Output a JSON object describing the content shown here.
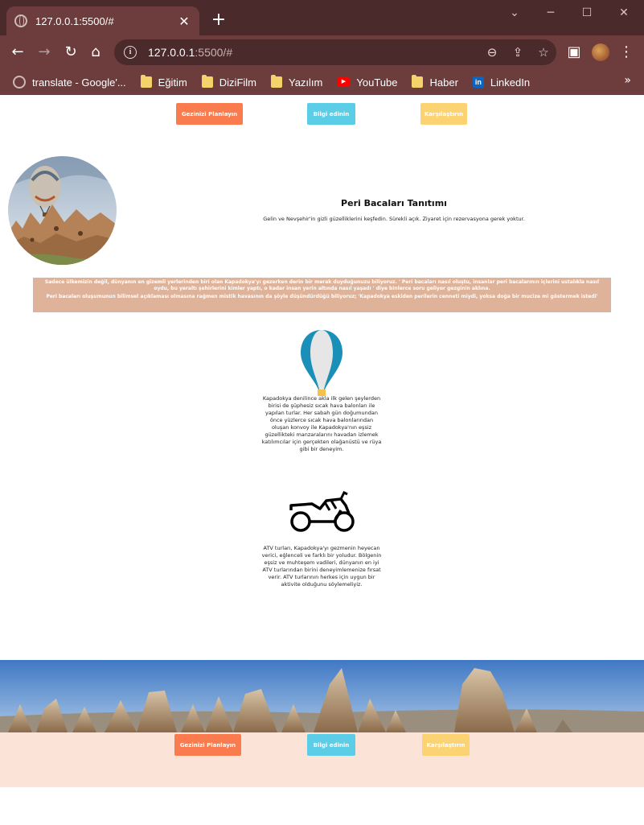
{
  "browser": {
    "tab_title": "127.0.0.1:5500/#",
    "url_host": "127.0.0.1",
    "url_rest": ":5500/#",
    "bookmarks": [
      {
        "label": "translate - Google'...",
        "icon": "google-icon"
      },
      {
        "label": "Eğitim",
        "icon": "folder-icon"
      },
      {
        "label": "DiziFilm",
        "icon": "folder-icon"
      },
      {
        "label": "Yazılım",
        "icon": "folder-icon"
      },
      {
        "label": "YouTube",
        "icon": "youtube-icon"
      },
      {
        "label": "Haber",
        "icon": "folder-icon"
      },
      {
        "label": "LinkedIn",
        "icon": "linkedin-icon"
      }
    ],
    "more": "»"
  },
  "nav": {
    "plan_label": "Gezinizi Planlayın",
    "info_label": "Bilgi edinin",
    "compare_label": "Karşılaştırın"
  },
  "intro": {
    "title": "Peri Bacaları Tanıtımı",
    "text": "Gelin ve Nevşehir'in gizli güzelliklerini keşfedin. Sürekli açık. Ziyaret için rezervasyona gerek yoktur."
  },
  "band": {
    "p1": "Sadece ülkemizin değil, dünyanın en gizemli yerlerinden biri olan Kapadokya'yı gezerken derin bir merak duyduğunuzu biliyoruz. ' Peri bacaları nasıl oluştu, insanlar peri bacalarının içlerini ustalıkla nasıl oydu, bu yeraltı şehirlerini kimler yaptı, o kadar insan yerin altında nasıl yaşadı ' diye binlerce soru geliyor gezginin aklına.",
    "p2": "Peri bacaları oluşumunun bilimsel açıklaması olmasına rağmen mistik havasının da şöyle düşündürdüğü biliyoruz; 'Kapadokya eskiden perilerin cenneti miydi, yoksa doğa bir mucize mi göstermek istedi'"
  },
  "features": {
    "balloon": "Kapadokya denilince akla ilk gelen şeylerden birisi de şüphesiz sıcak hava balonları ile yapılan turlar. Her sabah gün doğumundan önce yüzlerce sıcak hava balonlarından oluşan konvoy ile Kapadokya'nın eşsiz güzellikteki manzaralarını havadan izlemek katılımcılar için gerçekten olağanüstü ve rüya gibi bir deneyim.",
    "atv": "ATV turları, Kapadokya'yı gezmenin heyecan verici, eğlenceli ve farklı bir yoludur. Bölgenin eşsiz ve muhteşem vadileri, dünyanın en iyi ATV turlarından birini deneyimlemenize fırsat verir. ATV turlarının herkes için uygun bir aktivite olduğunu söylemeliyiz."
  },
  "colors": {
    "plan": "#f97b4e",
    "info": "#5bcde6",
    "compare": "#fcd372",
    "band": "#dfb39a",
    "footer": "#fbe4d7"
  }
}
